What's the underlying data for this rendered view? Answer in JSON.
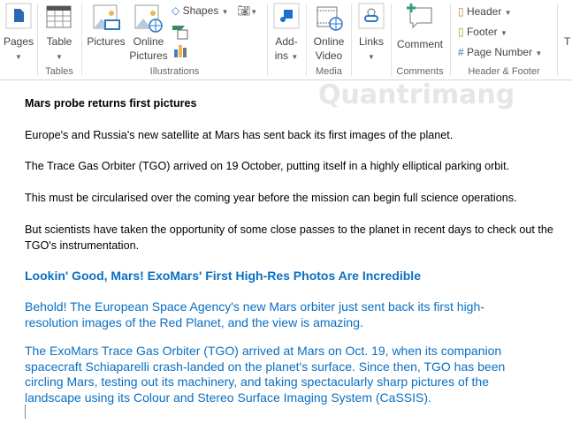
{
  "ribbon": {
    "pages": "Pages",
    "table": "Table",
    "pictures": "Pictures",
    "online_pictures_1": "Online",
    "online_pictures_2": "Pictures",
    "shapes": "Shapes",
    "addins_1": "Add-",
    "addins_2": "ins",
    "online_video_1": "Online",
    "online_video_2": "Video",
    "links": "Links",
    "comment": "Comment",
    "header": "Header",
    "footer": "Footer",
    "page_number": "Page Number",
    "groups": {
      "tables": "Tables",
      "illustrations": "Illustrations",
      "media": "Media",
      "comments": "Comments",
      "header_footer": "Header & Footer"
    }
  },
  "watermark": "Quantrimang",
  "document": {
    "title": "Mars probe returns first pictures",
    "p1": "Europe's and Russia's new satellite at Mars has sent back its first images of the planet.",
    "p2": "The Trace Gas Orbiter (TGO) arrived on 19 October, putting itself in a highly elliptical parking orbit.",
    "p3": "This must be circularised over the coming year before the mission can begin full science operations.",
    "p4": "But scientists have taken the opportunity of some close passes to the planet in recent days to check out the TGO's instrumentation.",
    "heading": "Lookin' Good, Mars! ExoMars' First High-Res Photos Are Incredible",
    "b1": "Behold! The European Space Agency's new Mars orbiter just sent back its first high-resolution images of the Red Planet, and the view is amazing.",
    "b2": "The ExoMars Trace Gas Orbiter (TGO) arrived at Mars on Oct. 19, when its companion spacecraft Schiaparelli crash-landed on the planet's surface. Since then, TGO has been circling Mars, testing out its machinery, and taking spectacularly sharp pictures of the landscape using its Colour and Stereo Surface Imaging System (CaSSIS)."
  }
}
